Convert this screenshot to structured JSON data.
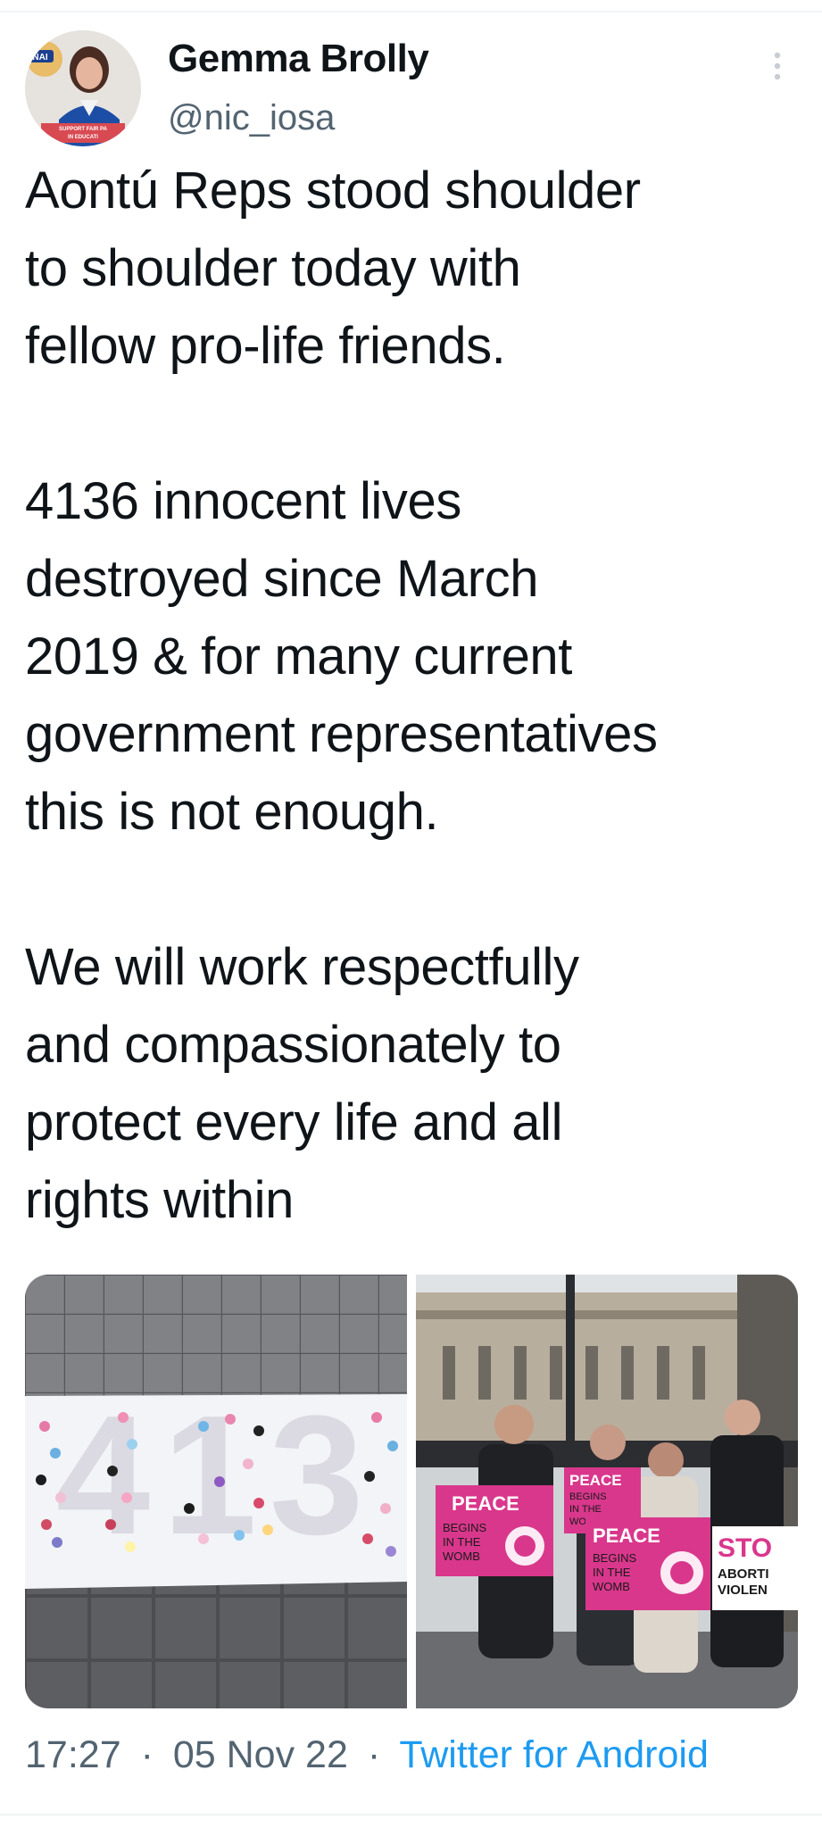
{
  "tweet": {
    "author": {
      "display_name": "Gemma Brolly",
      "handle": "@nic_iosa"
    },
    "text": "Aontú Reps stood shoulder\nto shoulder today with\nfellow pro-life friends.\n\n4136 innocent lives\ndestroyed since March\n2019 & for many current\ngovernment representatives\nthis is not enough.\n\nWe will work respectfully\nand compassionately to\nprotect every life and all\nrights within",
    "time": "17:27",
    "date": "05 Nov 22",
    "separator": "·",
    "source": "Twitter for Android"
  },
  "avatar_badge": {
    "brand_fragment": "NAI",
    "banner_text_1": "SUPPORT FAIR PA",
    "banner_text_2": "IN EDUCATI"
  },
  "media": {
    "left_photo": {
      "shoe_number_fragment": "413"
    },
    "right_photo": {
      "sign1": {
        "title": "PEACE",
        "lines": [
          "BEGINS",
          "IN THE",
          "WOMB"
        ]
      },
      "sign2": {
        "title": "PEACE",
        "lines": [
          "BEGINS",
          "IN THE",
          "WOMB"
        ]
      },
      "sign3": {
        "title": "PEACE",
        "lines": [
          "BEGINS",
          "IN THE",
          "WOMB"
        ]
      },
      "sign4": {
        "line1": "STO",
        "line2": "ABORTI",
        "line3": "VIOLEN"
      }
    }
  },
  "colors": {
    "link": "#1d9bf0",
    "secondary_text": "#536471",
    "primary_text": "#0f1419",
    "sign_pink": "#d9378c"
  },
  "icons": {
    "more": "more-vertical-icon"
  }
}
